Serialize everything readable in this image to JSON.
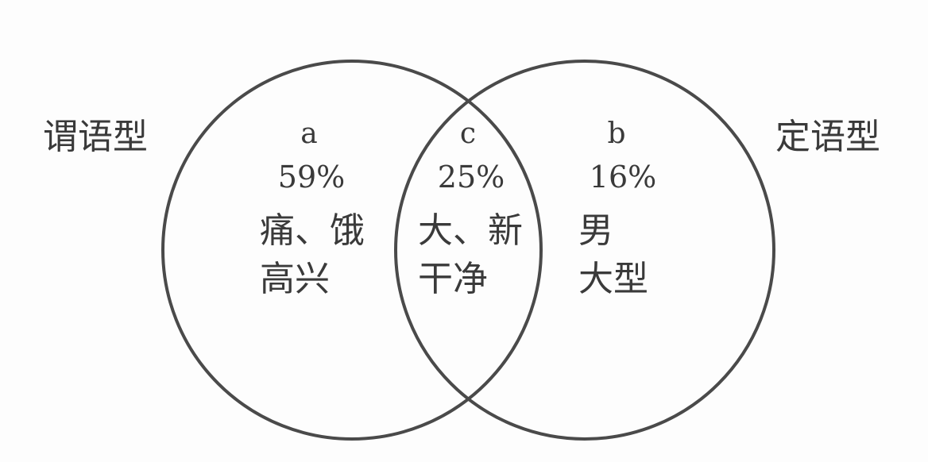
{
  "left_set": {
    "label": "谓语型"
  },
  "right_set": {
    "label": "定语型"
  },
  "regions": {
    "a": {
      "letter": "a",
      "percent": "59%",
      "line1": "痛、饿",
      "line2": "高兴"
    },
    "c": {
      "letter": "c",
      "percent": "25%",
      "line1": "大、新",
      "line2": "干净"
    },
    "b": {
      "letter": "b",
      "percent": "16%",
      "line1": "男",
      "line2": "大型"
    }
  }
}
